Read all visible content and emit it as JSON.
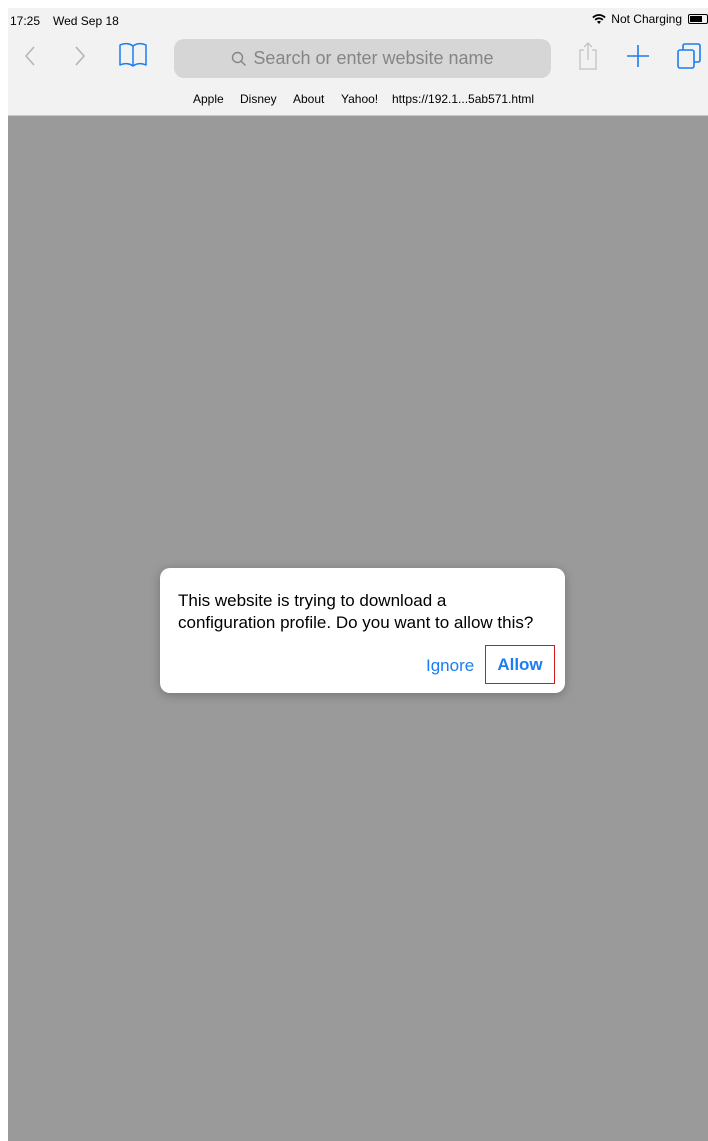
{
  "status_bar": {
    "time": "17:25",
    "date": "Wed Sep 18",
    "charging": "Not Charging"
  },
  "toolbar": {
    "search_placeholder": "Search or enter website name"
  },
  "favorites": [
    "Apple",
    "Disney",
    "About",
    "Yahoo!",
    "https://192.1...5ab571.html"
  ],
  "dialog": {
    "message": "This website is trying to download a configuration profile. Do you want to allow this?",
    "ignore_label": "Ignore",
    "allow_label": "Allow"
  },
  "colors": {
    "accent": "#1a7df1",
    "highlight_border": "#d11a1a",
    "page_background": "#9a9a9a"
  }
}
